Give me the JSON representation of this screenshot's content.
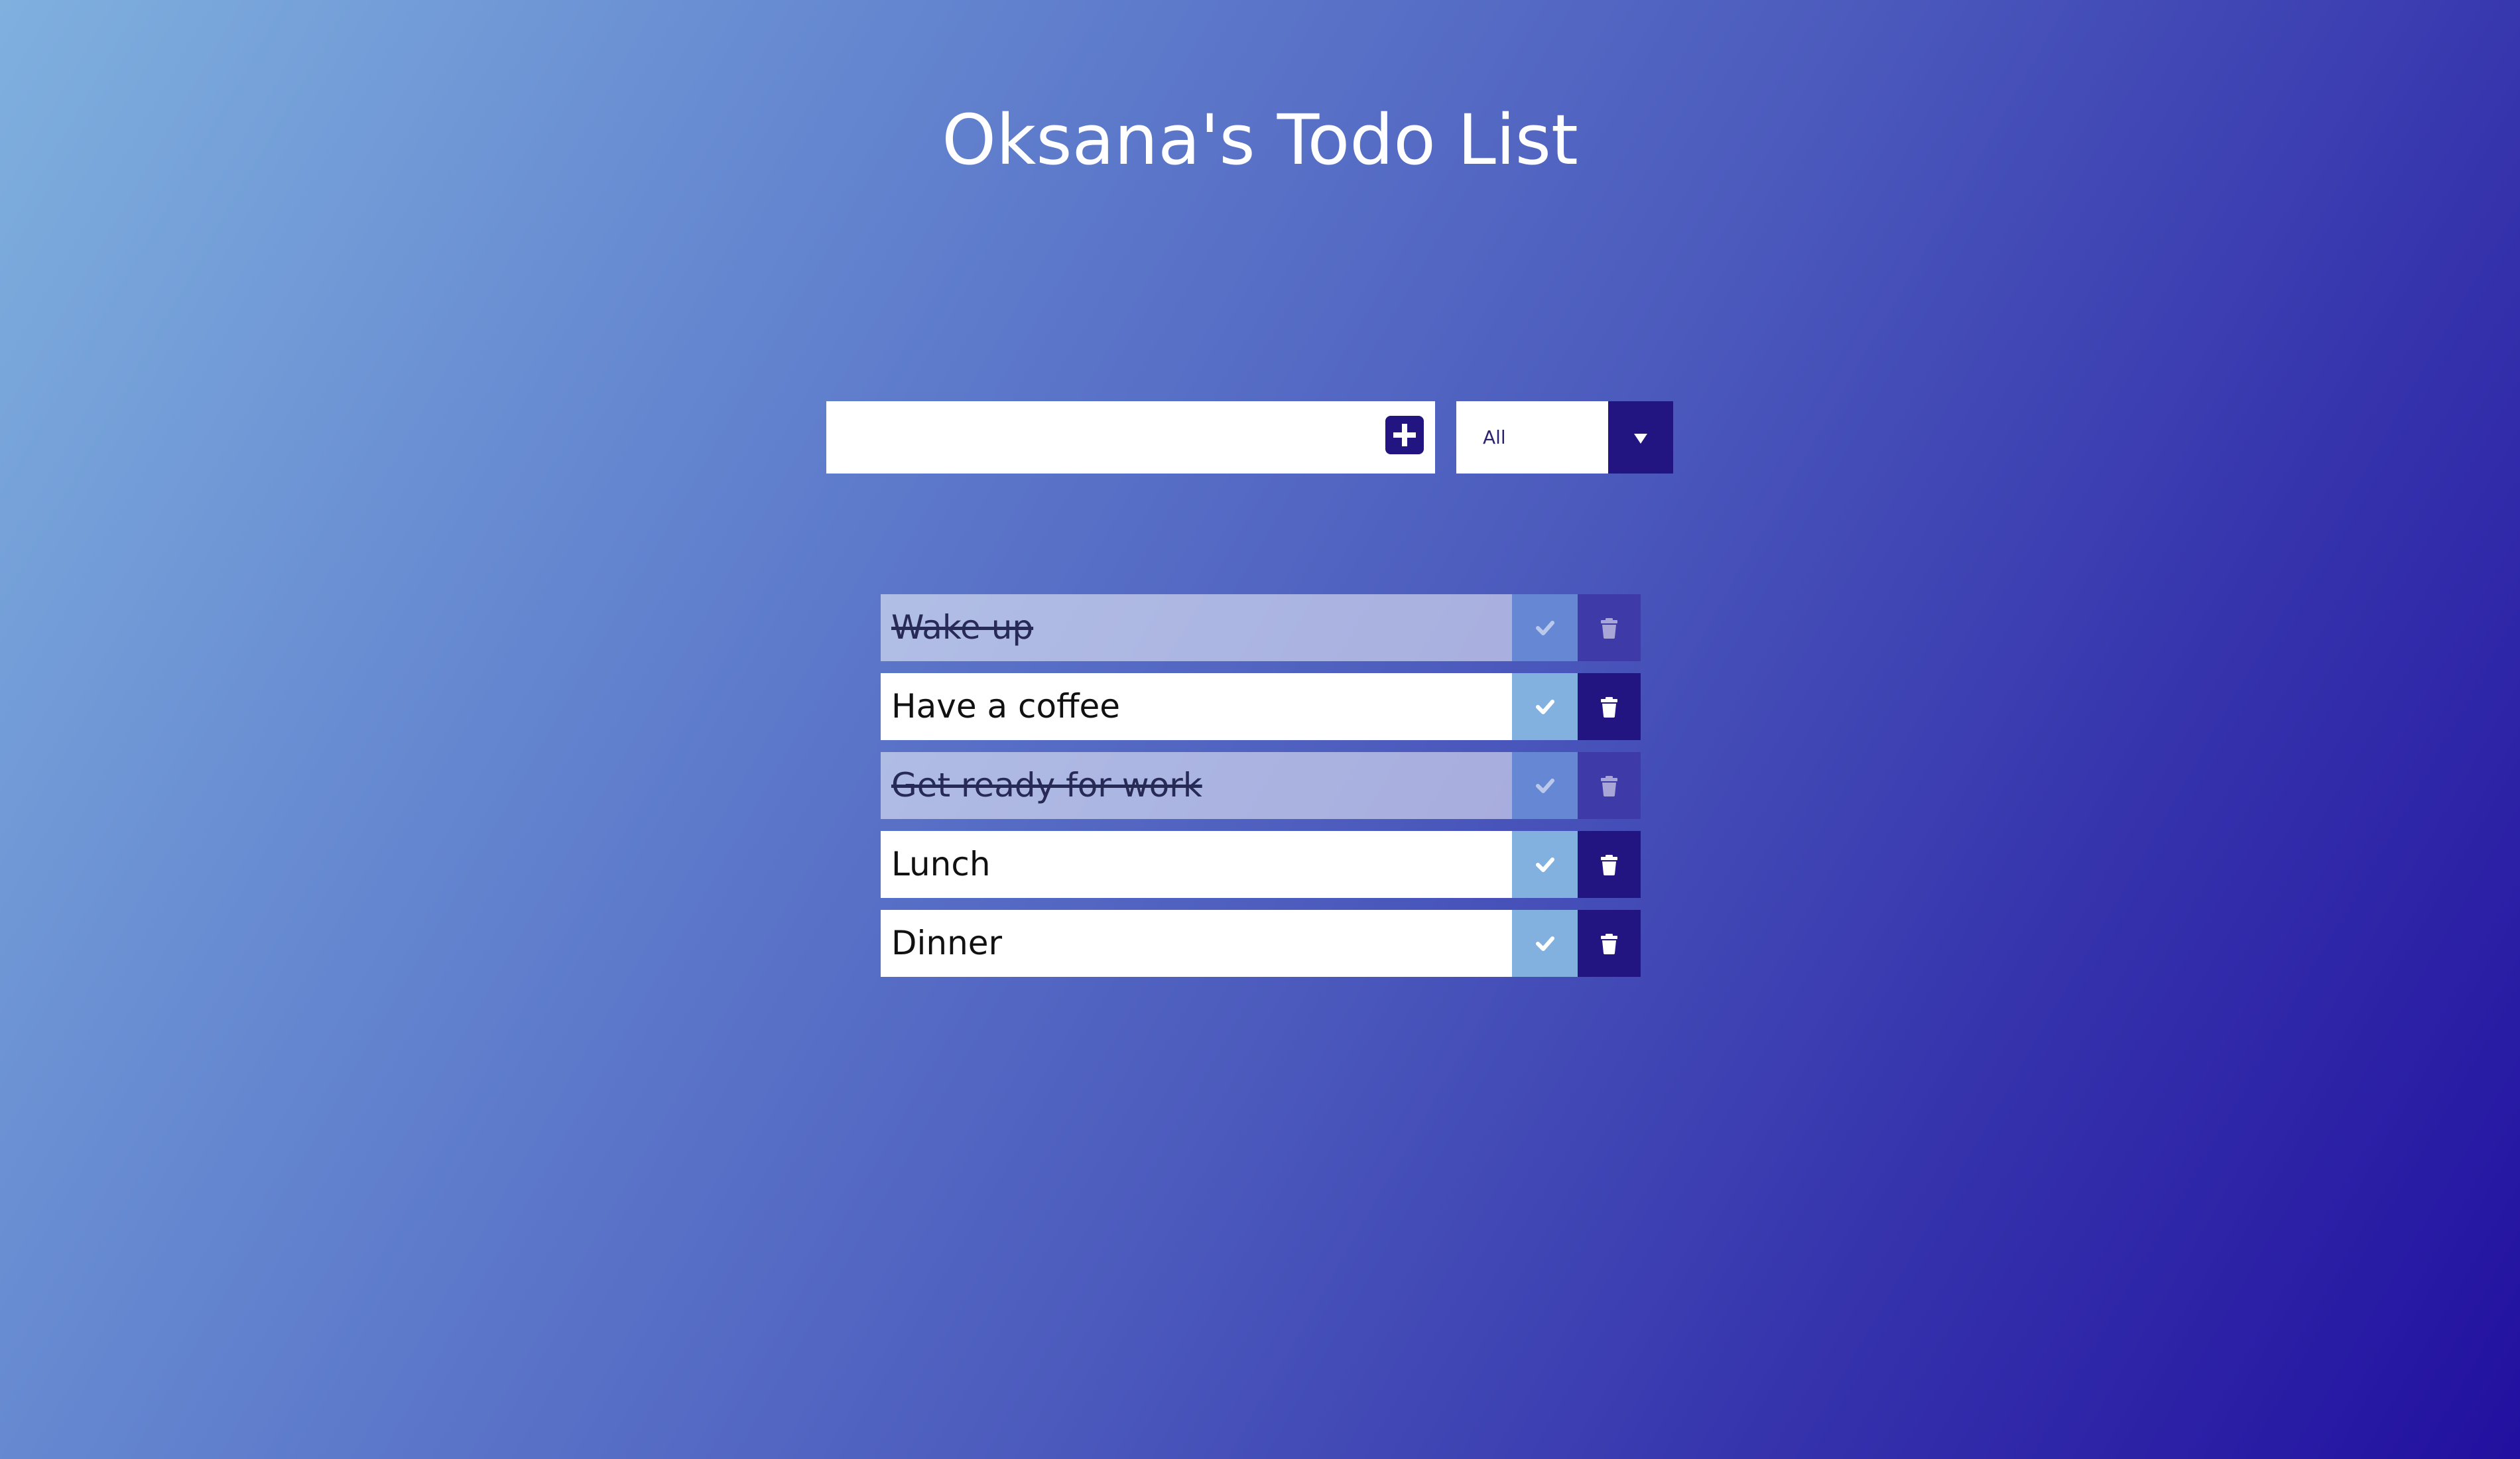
{
  "header": {
    "title": "Oksana's Todo List"
  },
  "form": {
    "input_value": "",
    "input_placeholder": "",
    "add_icon": "plus-icon",
    "filter": {
      "selected": "All",
      "icon": "chevron-down-icon"
    }
  },
  "todos": [
    {
      "text": "Wake up",
      "completed": true
    },
    {
      "text": "Have a coffee",
      "completed": false
    },
    {
      "text": "Get ready for work",
      "completed": true
    },
    {
      "text": "Lunch",
      "completed": false
    },
    {
      "text": "Dinner",
      "completed": false
    }
  ],
  "icons": {
    "complete": "check-icon",
    "delete": "trash-icon"
  },
  "colors": {
    "accent_dark": "#221582",
    "check_bg": "#82b1e0",
    "gradient_start": "#7fb0de",
    "gradient_end": "#2210a0"
  }
}
